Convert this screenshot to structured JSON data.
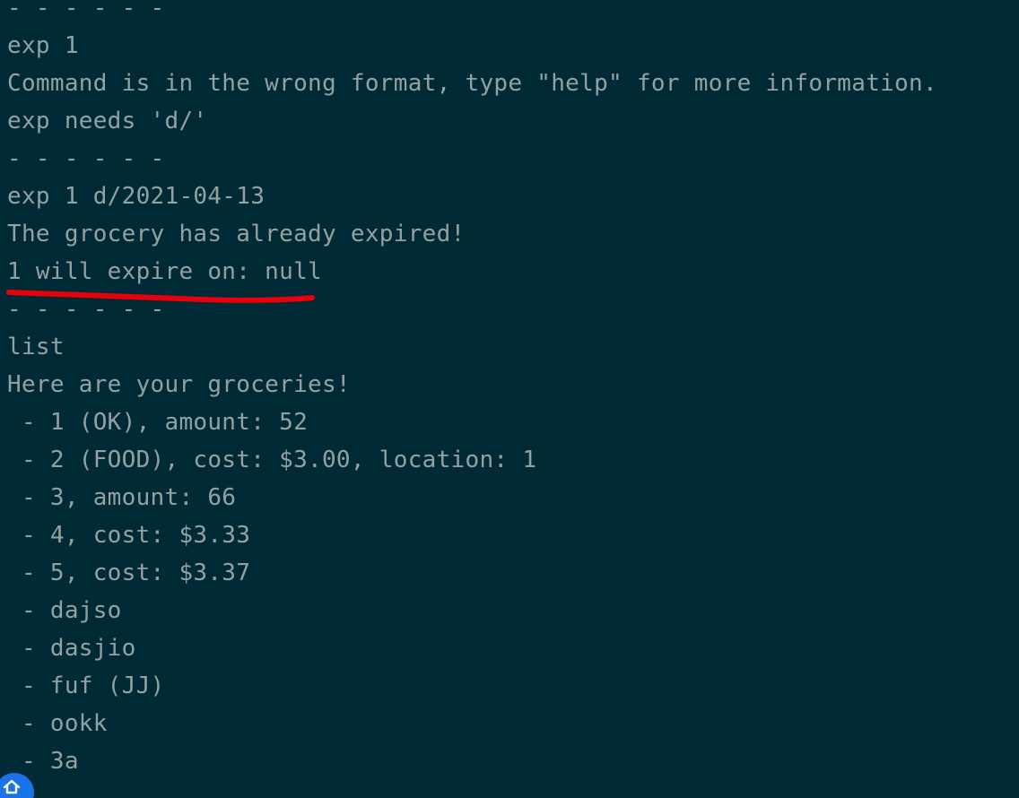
{
  "terminal": {
    "lines": [
      "- - - - - -",
      "exp 1",
      "Command is in the wrong format, type \"help\" for more information.",
      "exp needs 'd/'",
      "- - - - - -",
      "exp 1 d/2021-04-13",
      "The grocery has already expired!",
      "1 will expire on: null",
      "- - - - - -",
      "list",
      "Here are your groceries!",
      " - 1 (OK), amount: 52",
      " - 2 (FOOD), cost: $3.00, location: 1",
      " - 3, amount: 66",
      " - 4, cost: $3.33",
      " - 5, cost: $3.37",
      " - dajso",
      " - dasjio",
      " - fuf (JJ)",
      " - ookk",
      " - 3a"
    ]
  },
  "colors": {
    "background": "#002b36",
    "text": "#93a1a1",
    "annotation": "#e8000b",
    "corner_icon": "#1a73e8"
  },
  "icons": {
    "corner": "home-icon"
  }
}
